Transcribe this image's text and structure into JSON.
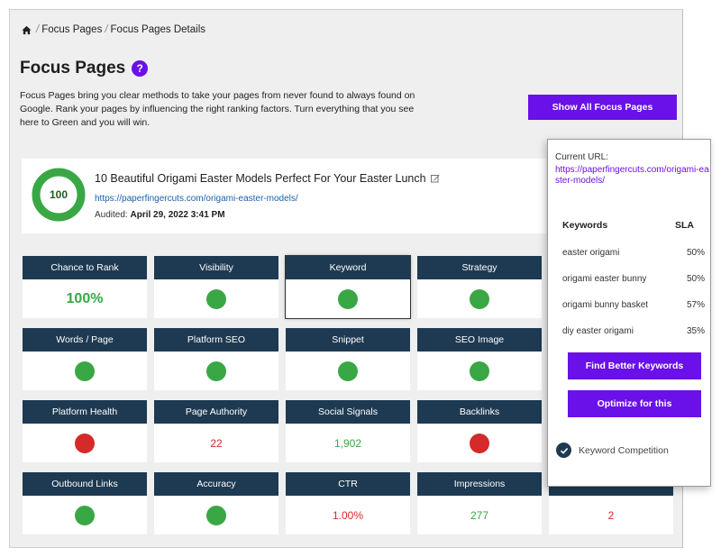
{
  "breadcrumb": {
    "home_icon": "home-icon",
    "items": [
      "Focus Pages",
      "Focus Pages Details"
    ]
  },
  "header": {
    "title": "Focus Pages",
    "help_icon": "?",
    "description": "Focus Pages bring you clear methods to take your pages from never found to always found on Google. Rank your pages by influencing the right ranking factors. Turn everything that you see here to Green and you will win.",
    "show_all_label": "Show All Focus Pages"
  },
  "page_card": {
    "score": "100",
    "title": "10 Beautiful Origami Easter Models Perfect For Your Easter Lunch",
    "url": "https://paperfingercuts.com/origami-easter-models/",
    "audited_label": "Audited:",
    "audited_date": "April 29, 2022 3:41 PM"
  },
  "metrics": [
    {
      "label": "Chance to Rank",
      "value": "100%",
      "status": "green",
      "kind": "text"
    },
    {
      "label": "Visibility",
      "status": "green",
      "kind": "dot"
    },
    {
      "label": "Keyword",
      "status": "green",
      "kind": "dot",
      "selected": true
    },
    {
      "label": "Strategy",
      "status": "green",
      "kind": "dot"
    },
    {
      "label": "Words / Page",
      "status": "green",
      "kind": "dot"
    },
    {
      "label": "Platform SEO",
      "status": "green",
      "kind": "dot"
    },
    {
      "label": "Snippet",
      "status": "green",
      "kind": "dot"
    },
    {
      "label": "SEO Image",
      "status": "green",
      "kind": "dot"
    },
    {
      "label": "Platform Health",
      "status": "red",
      "kind": "dot"
    },
    {
      "label": "Page Authority",
      "value": "22",
      "status": "red",
      "kind": "text"
    },
    {
      "label": "Social Signals",
      "value": "1,902",
      "status": "green",
      "kind": "text"
    },
    {
      "label": "Backlinks",
      "status": "red",
      "kind": "dot"
    },
    {
      "label": "Outbound Links",
      "status": "green",
      "kind": "dot"
    },
    {
      "label": "Accuracy",
      "status": "green",
      "kind": "dot"
    },
    {
      "label": "CTR",
      "value": "1.00%",
      "status": "red",
      "kind": "text"
    },
    {
      "label": "Impressions",
      "value": "277",
      "status": "green",
      "kind": "text"
    },
    {
      "label": "",
      "value": "2",
      "status": "red",
      "kind": "text"
    }
  ],
  "side_panel": {
    "current_url_label": "Current URL:",
    "current_url": "https://paperfingercuts.com/origami-easter-models/",
    "keywords_header": "Keywords",
    "sla_header": "SLA",
    "keywords": [
      {
        "keyword": "easter origami",
        "sla": "50%"
      },
      {
        "keyword": "origami easter bunny",
        "sla": "50%"
      },
      {
        "keyword": "origami bunny basket",
        "sla": "57%"
      },
      {
        "keyword": "diy easter origami",
        "sla": "35%"
      }
    ],
    "find_better_label": "Find Better Keywords",
    "optimize_label": "Optimize for this",
    "competition_label": "Keyword Competition"
  },
  "colors": {
    "accent": "#6a10e8",
    "header_navy": "#1e3a52",
    "good": "#3aa745",
    "bad": "#d42a2a"
  }
}
